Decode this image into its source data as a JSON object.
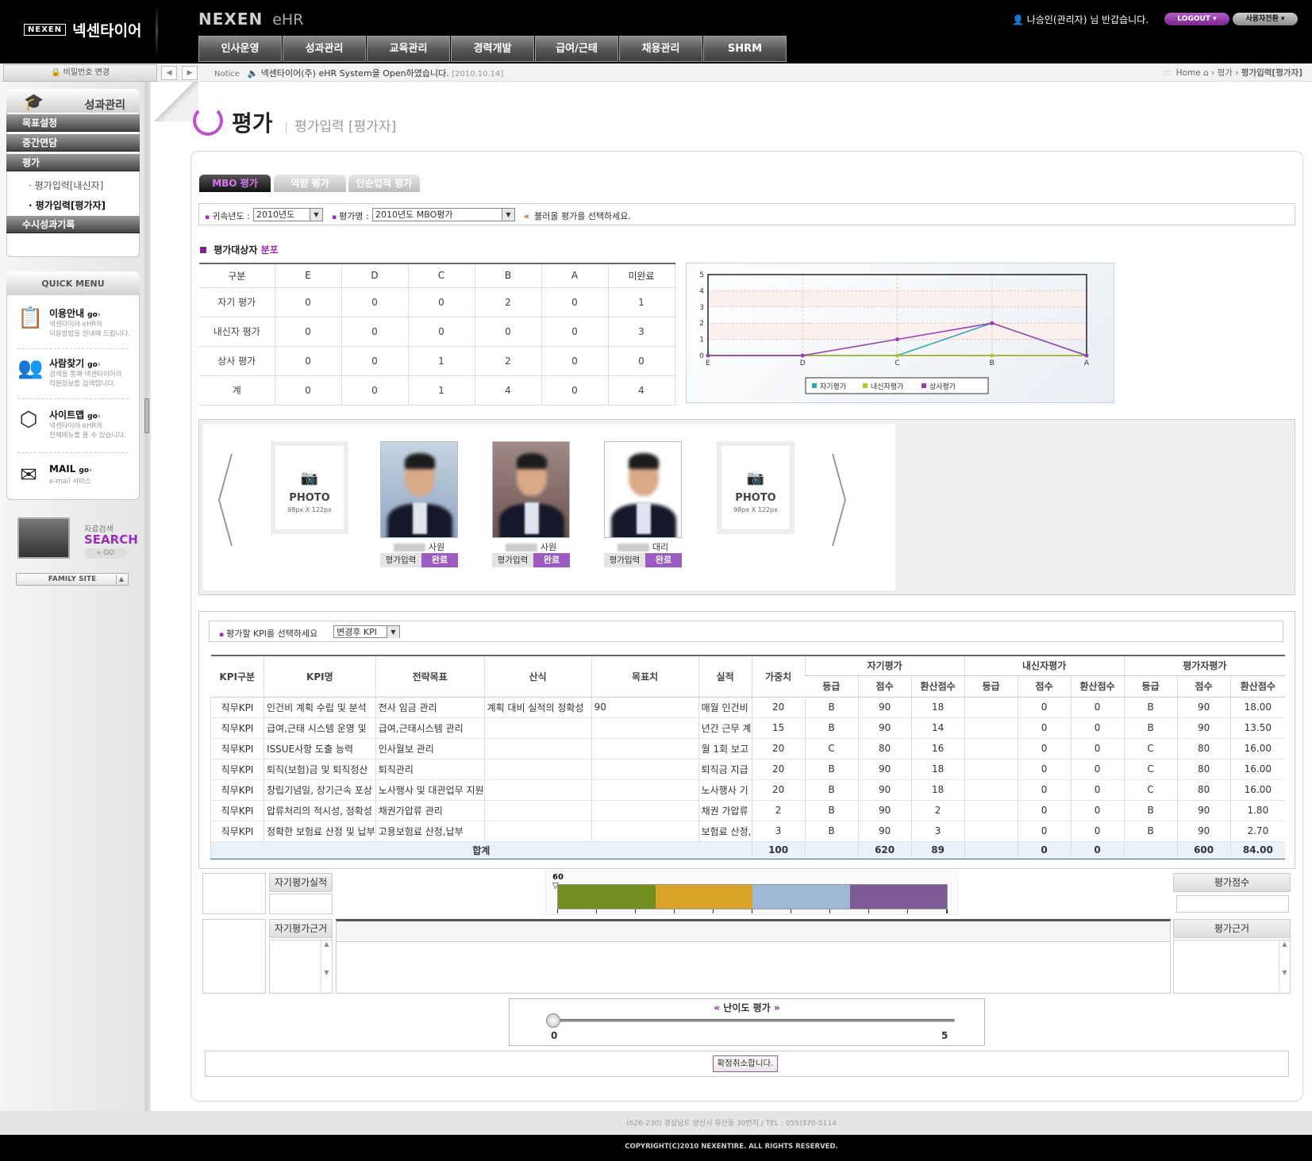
{
  "header": {
    "logo_text": "넥센타이어",
    "logo_mark": "NEXEN",
    "brand_main": "NEXEN",
    "brand_sub": "eHR",
    "welcome": "나승인(관리자) 님 반갑습니다.",
    "logout_label": "LOGOUT ▾",
    "switch_user_label": "사용자전환 ▾",
    "nav": [
      "인사운영",
      "성과관리",
      "교육관리",
      "경력개발",
      "급여/근태",
      "채용관리",
      "SHRM"
    ]
  },
  "noticebar": {
    "password_change": "비밀번호 변경",
    "notice_label": "Notice",
    "notice_text": "넥센타이어(주) eHR System을 Open하였습니다.",
    "notice_date": "[2010.10.14]",
    "breadcrumb": [
      "Home",
      "평가",
      "평가입력[평가자]"
    ]
  },
  "sidebar": {
    "menu_title": "성과관리",
    "menu": [
      {
        "label": "목표설정"
      },
      {
        "label": "중간면담"
      },
      {
        "label": "평가"
      },
      {
        "label": "수시성과기록"
      }
    ],
    "submenu": [
      {
        "label": "· 평가입력[내신자]",
        "active": false
      },
      {
        "label": "· 평가입력[평가자]",
        "active": true
      }
    ],
    "quick_menu_title": "QUICK MENU",
    "quick_items": [
      {
        "title": "이용안내",
        "go": "go",
        "desc": "넥센타이어 eHR의\n이용방법을 안내해 드립니다.",
        "icon": "calendar-icon"
      },
      {
        "title": "사람찾기",
        "go": "go",
        "desc": "검색을 통해 넥센타이어의\n직원정보를 검색합니다.",
        "icon": "people-icon"
      },
      {
        "title": "사이트맵",
        "go": "go",
        "desc": "넥센타이어 eHR의\n전체메뉴를 볼 수 있습니다.",
        "icon": "cube-icon"
      },
      {
        "title": "MAIL",
        "go": "go",
        "desc": "e-mail 서비스",
        "icon": "mail-icon"
      }
    ],
    "search_label": "자료검색",
    "search_big": "SEARCH",
    "search_go": "» GO",
    "family_site": "FAMILY SITE"
  },
  "page": {
    "title": "평가",
    "subtitle": "평가입력 [평가자]",
    "tabs": [
      {
        "label": "MBO 평가",
        "active": true
      },
      {
        "label": "역량 평가",
        "active": false
      },
      {
        "label": "단순업적 평가",
        "active": false
      }
    ],
    "filter": {
      "year_label": "귀속년도 :",
      "year_value": "2010년도",
      "eval_label": "평가명 :",
      "eval_value": "2010년도 MBO평가",
      "hint": "불러올 평가를 선택하세요."
    },
    "section_title_a": "평가대상자",
    "section_title_b": "분포"
  },
  "distribution": {
    "headers": [
      "구분",
      "E",
      "D",
      "C",
      "B",
      "A",
      "미완료"
    ],
    "rows": [
      [
        "자기 평가",
        "0",
        "0",
        "0",
        "2",
        "0",
        "1"
      ],
      [
        "내신자 평가",
        "0",
        "0",
        "0",
        "0",
        "0",
        "3"
      ],
      [
        "상사 평가",
        "0",
        "0",
        "1",
        "2",
        "0",
        "0"
      ],
      [
        "계",
        "0",
        "0",
        "1",
        "4",
        "0",
        "4"
      ]
    ]
  },
  "chart_data": {
    "type": "line",
    "categories": [
      "E",
      "D",
      "C",
      "B",
      "A"
    ],
    "ylim": [
      0,
      5
    ],
    "yticks": [
      "0",
      "1",
      "2",
      "3",
      "4",
      "5"
    ],
    "series": [
      {
        "name": "자기평가",
        "values": [
          0,
          0,
          0,
          2,
          0
        ],
        "color": "#2aa7b8"
      },
      {
        "name": "내신자평가",
        "values": [
          0,
          0,
          0,
          0,
          0
        ],
        "color": "#b8c628"
      },
      {
        "name": "상사평가",
        "values": [
          0,
          0,
          1,
          2,
          0
        ],
        "color": "#9a3db0"
      }
    ],
    "grid": true,
    "legend": "bottom"
  },
  "photos": {
    "placeholder_title": "PHOTO",
    "placeholder_size": "98px X 122px",
    "people": [
      {
        "position": "사원",
        "input_label": "평가입력",
        "status": "완료"
      },
      {
        "position": "사원",
        "input_label": "평가입력",
        "status": "완료"
      },
      {
        "position": "대리",
        "input_label": "평가입력",
        "status": "완료"
      }
    ]
  },
  "kpi": {
    "select_label": "평가할 KPI를 선택하세요",
    "select_value": "변경후 KPI",
    "group_headers": [
      "자기평가",
      "내신자평가",
      "평가자평가"
    ],
    "col_headers": [
      "KPI구분",
      "KPI명",
      "전략목표",
      "산식",
      "목표치",
      "실적",
      "가중치"
    ],
    "sub_headers": [
      "등급",
      "점수",
      "환산점수",
      "등급",
      "점수",
      "환산점수",
      "등급",
      "점수",
      "환산점수"
    ],
    "rows": [
      [
        "직무KPI",
        "인건비 계획 수립 및 분석",
        "전사 임금 관리",
        "계획 대비 실적의 정확성",
        "90",
        "매월 인건비",
        "20",
        "B",
        "90",
        "18",
        "",
        "0",
        "0",
        "B",
        "90",
        "18.00"
      ],
      [
        "직무KPI",
        "급여,근태 시스템 운영 및",
        "급여,근태시스템 관리",
        "",
        "",
        "년간 근무 계",
        "15",
        "B",
        "90",
        "14",
        "",
        "0",
        "0",
        "B",
        "90",
        "13.50"
      ],
      [
        "직무KPI",
        "ISSUE사항 도출 능력",
        "인사월보 관리",
        "",
        "",
        "월 1회 보고",
        "20",
        "C",
        "80",
        "16",
        "",
        "0",
        "0",
        "C",
        "80",
        "16.00"
      ],
      [
        "직무KPI",
        "퇴직(보험)금 및 퇴직정산",
        "퇴직관리",
        "",
        "",
        "퇴직금 지급",
        "20",
        "B",
        "90",
        "18",
        "",
        "0",
        "0",
        "C",
        "80",
        "16.00"
      ],
      [
        "직무KPI",
        "창립기념일, 장기근속 포상",
        "노사행사 및 대관업무 지원",
        "",
        "",
        "노사행사 기",
        "20",
        "B",
        "90",
        "18",
        "",
        "0",
        "0",
        "C",
        "80",
        "16.00"
      ],
      [
        "직무KPI",
        "압류처리의 적시성, 정확성",
        "채권가압류 관리",
        "",
        "",
        "채권 가압류",
        "2",
        "B",
        "90",
        "2",
        "",
        "0",
        "0",
        "B",
        "90",
        "1.80"
      ],
      [
        "직무KPI",
        "정확한 보험료 산정 및 납부",
        "고용보험료 산정,납부",
        "",
        "",
        "보험료 산정,",
        "3",
        "B",
        "90",
        "3",
        "",
        "0",
        "0",
        "B",
        "90",
        "2.70"
      ]
    ],
    "total_label": "합계",
    "totals": [
      "100",
      "",
      "620",
      "89",
      "",
      "0",
      "0",
      "",
      "600",
      "84.00"
    ]
  },
  "bottom": {
    "self_result_label": "자기평가실적",
    "self_basis_label": "자기평가근거",
    "eval_score_label": "평가점수",
    "eval_basis_label": "평가근거",
    "gauge_value": "60",
    "gauge_colors": [
      "#6f8e1d",
      "#d9a228",
      "#9fb8d6",
      "#7d5c96"
    ],
    "difficulty_title": "난이도 평가",
    "slider_min": "0",
    "slider_max": "5",
    "slider_value": 0,
    "cancel_button": "확정취소합니다."
  },
  "footer": {
    "address": "(626-230) 경상남도 양산시 유산동 30번지   /   TEL : 055)370-5114",
    "copyright": "COPYRIGHT(C)2010 NEXENTIRE. ALL RIGHTS RESERVED."
  }
}
